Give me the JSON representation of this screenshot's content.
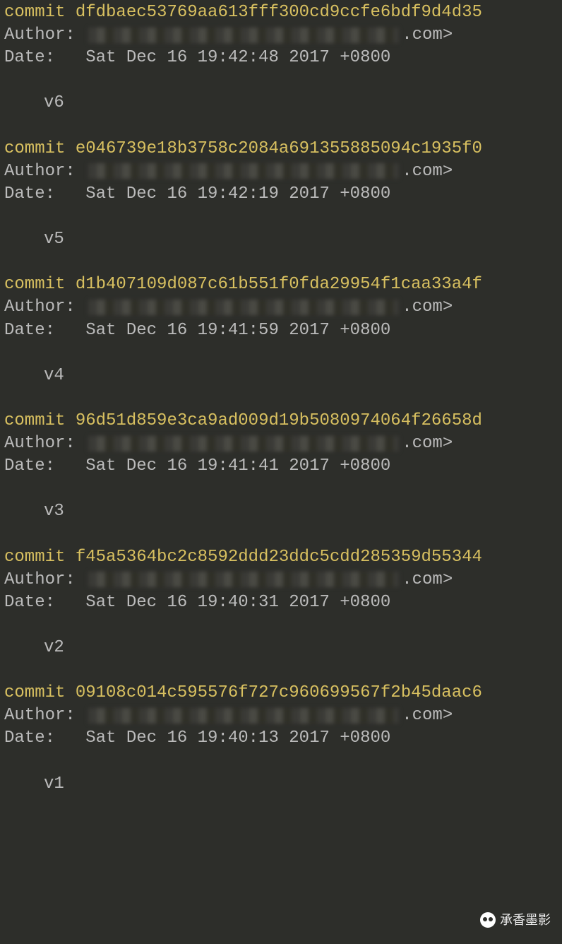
{
  "labels": {
    "commit": "commit",
    "author": "Author:",
    "date": "Date:  "
  },
  "commits": [
    {
      "hash": "dfdbaec53769aa613fff300cd9ccfe6bdf9d4d35",
      "author_visible_tail": ".com>",
      "date": "Sat Dec 16 19:42:48 2017 +0800",
      "message": "v6"
    },
    {
      "hash": "e046739e18b3758c2084a691355885094c1935f0",
      "author_visible_tail": ".com>",
      "date": "Sat Dec 16 19:42:19 2017 +0800",
      "message": "v5"
    },
    {
      "hash": "d1b407109d087c61b551f0fda29954f1caa33a4f",
      "author_visible_tail": ".com>",
      "date": "Sat Dec 16 19:41:59 2017 +0800",
      "message": "v4"
    },
    {
      "hash": "96d51d859e3ca9ad009d19b5080974064f26658d",
      "author_visible_tail": ".com>",
      "date": "Sat Dec 16 19:41:41 2017 +0800",
      "message": "v3"
    },
    {
      "hash": "f45a5364bc2c8592ddd23ddc5cdd285359d55344",
      "author_visible_tail": ".com>",
      "date": "Sat Dec 16 19:40:31 2017 +0800",
      "message": "v2"
    },
    {
      "hash": "09108c014c595576f727c960699567f2b45daac6",
      "author_visible_tail": ".com>",
      "date": "Sat Dec 16 19:40:13 2017 +0800",
      "message": "v1"
    }
  ],
  "watermark": {
    "text": "承香墨影",
    "icon": "wechat-icon"
  }
}
